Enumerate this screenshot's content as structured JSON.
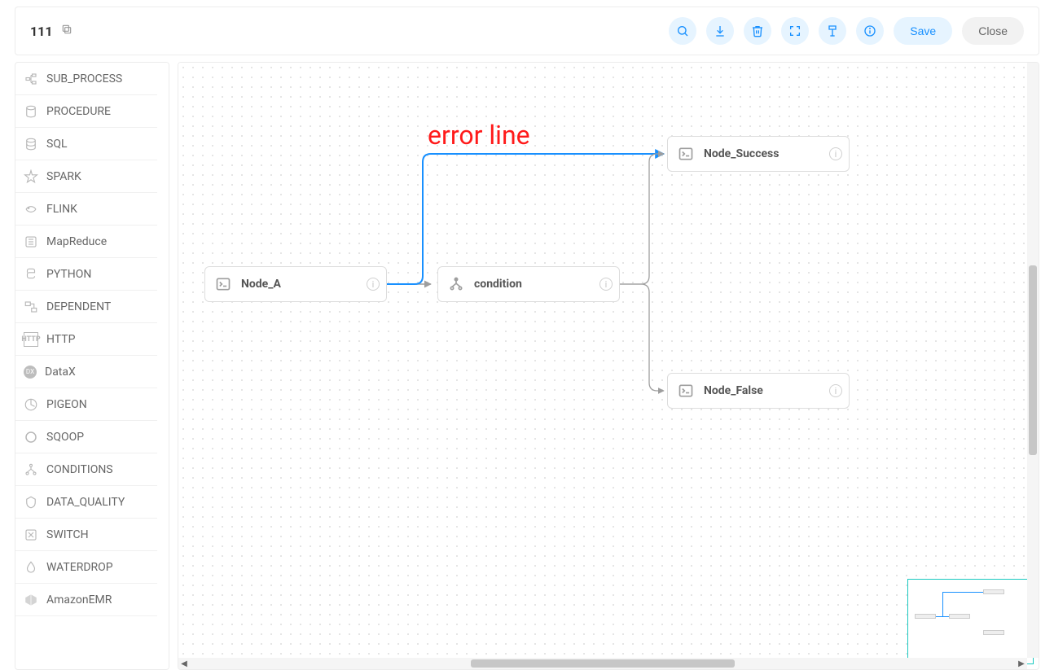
{
  "header": {
    "title": "111",
    "save_label": "Save",
    "close_label": "Close"
  },
  "palette": {
    "items": [
      {
        "label": "SUB_PROCESS",
        "icon": "subprocess"
      },
      {
        "label": "PROCEDURE",
        "icon": "procedure"
      },
      {
        "label": "SQL",
        "icon": "sql"
      },
      {
        "label": "SPARK",
        "icon": "spark"
      },
      {
        "label": "FLINK",
        "icon": "flink"
      },
      {
        "label": "MapReduce",
        "icon": "mapreduce"
      },
      {
        "label": "PYTHON",
        "icon": "python"
      },
      {
        "label": "DEPENDENT",
        "icon": "dependent"
      },
      {
        "label": "HTTP",
        "icon": "http"
      },
      {
        "label": "DataX",
        "icon": "datax"
      },
      {
        "label": "PIGEON",
        "icon": "pigeon"
      },
      {
        "label": "SQOOP",
        "icon": "sqoop"
      },
      {
        "label": "CONDITIONS",
        "icon": "conditions"
      },
      {
        "label": "DATA_QUALITY",
        "icon": "dataquality"
      },
      {
        "label": "SWITCH",
        "icon": "switch"
      },
      {
        "label": "WATERDROP",
        "icon": "waterdrop"
      },
      {
        "label": "AmazonEMR",
        "icon": "emr"
      }
    ]
  },
  "annotation": "error line",
  "nodes": {
    "a": {
      "label": "Node_A",
      "icon": "shell"
    },
    "cond": {
      "label": "condition",
      "icon": "conditions"
    },
    "success": {
      "label": "Node_Success",
      "icon": "shell"
    },
    "false": {
      "label": "Node_False",
      "icon": "shell"
    }
  },
  "colors": {
    "accent": "#1890ff",
    "error": "#ff1a1a",
    "minimap_border": "#18c9c0"
  }
}
